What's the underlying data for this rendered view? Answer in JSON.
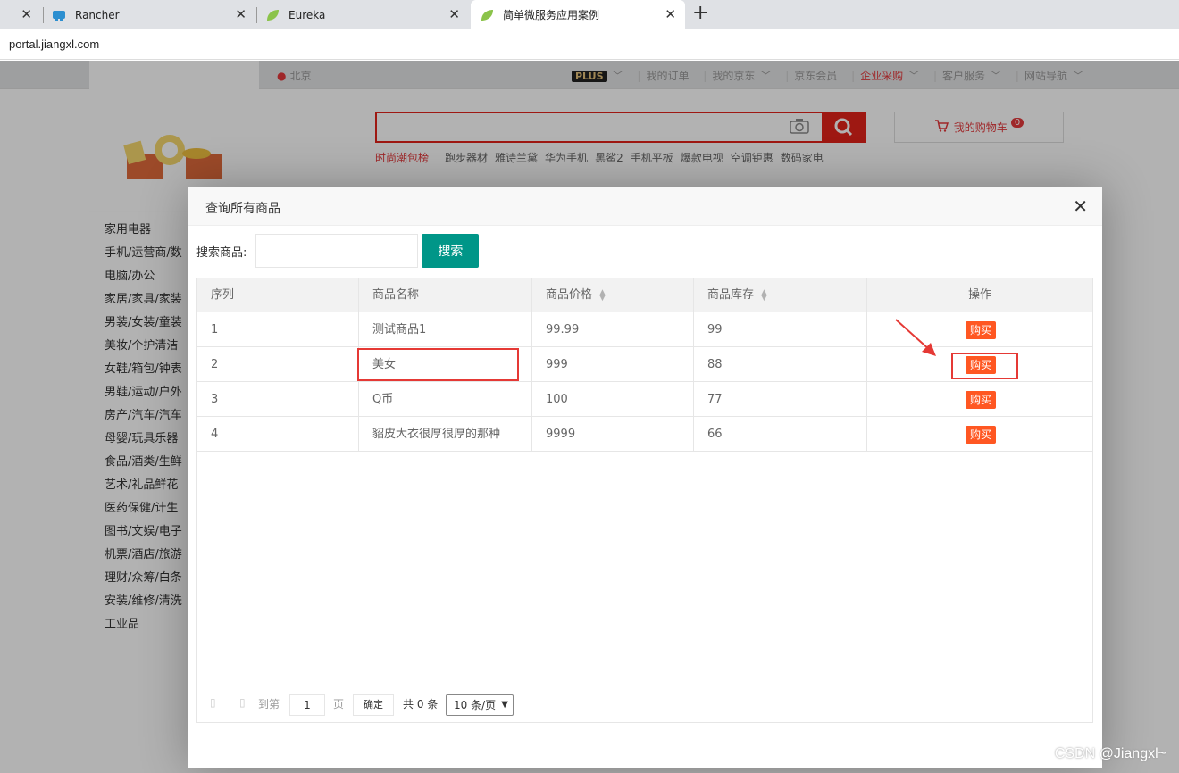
{
  "browser": {
    "tabs": [
      {
        "label": ""
      },
      {
        "label": "Rancher"
      },
      {
        "label": "Eureka"
      },
      {
        "label": "简单微服务应用案例"
      }
    ],
    "url": "portal.jiangxl.com"
  },
  "site": {
    "location": "北京",
    "plus": "PLUS",
    "nav": [
      "我的订单",
      "我的京东",
      "京东会员",
      "企业采购",
      "客户服务",
      "网站导航"
    ],
    "cart_label": "我的购物车",
    "cart_count": "0",
    "hot_words": [
      "时尚潮包榜",
      "跑步器材",
      "雅诗兰黛",
      "华为手机",
      "黑鲨2",
      "手机平板",
      "爆款电视",
      "空调钜惠",
      "数码家电"
    ],
    "categories": [
      "家用电器",
      "手机/运营商/数",
      "电脑/办公",
      "家居/家具/家装",
      "男装/女装/童装",
      "美妆/个护清洁",
      "女鞋/箱包/钟表",
      "男鞋/运动/户外",
      "房产/汽车/汽车",
      "母婴/玩具乐器",
      "食品/酒类/生鲜",
      "艺术/礼品鲜花",
      "医药保健/计生",
      "图书/文娱/电子",
      "机票/酒店/旅游",
      "理财/众筹/白条",
      "安装/维修/清洗",
      "工业品"
    ]
  },
  "modal": {
    "title": "查询所有商品",
    "search_label": "搜索商品:",
    "search_button": "搜索",
    "columns": [
      "序列",
      "商品名称",
      "商品价格",
      "商品库存",
      "操作"
    ],
    "rows": [
      {
        "id": "1",
        "name": "测试商品1",
        "price": "99.99",
        "stock": "99",
        "action": "购买"
      },
      {
        "id": "2",
        "name": "美女",
        "price": "999",
        "stock": "88",
        "action": "购买"
      },
      {
        "id": "3",
        "name": "Q币",
        "price": "100",
        "stock": "77",
        "action": "购买"
      },
      {
        "id": "4",
        "name": "貂皮大衣很厚很厚的那种",
        "price": "9999",
        "stock": "66",
        "action": "购买"
      }
    ],
    "pager": {
      "goto": "到第",
      "page_value": "1",
      "page_unit": "页",
      "confirm": "确定",
      "total": "共 0 条",
      "page_size": "10 条/页"
    }
  },
  "watermark": "CSDN @Jiangxl~",
  "colors": {
    "accent": "#009688",
    "buy": "#ff5722",
    "jd_red": "#e4393c",
    "highlight": "#e53935"
  }
}
